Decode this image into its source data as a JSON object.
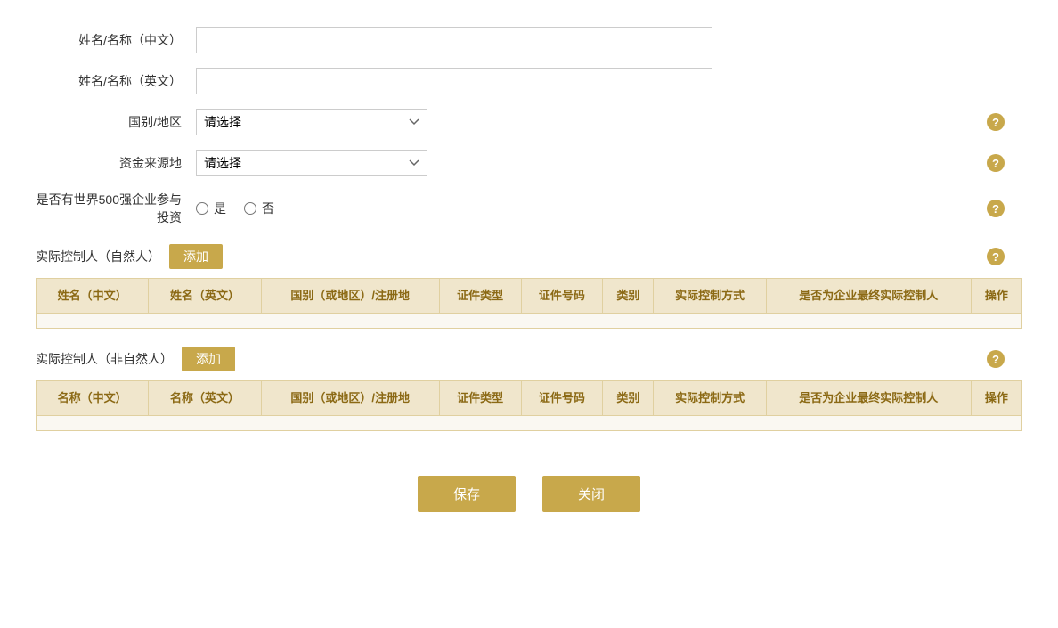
{
  "form": {
    "name_cn_label": "姓名/名称（中文）",
    "name_en_label": "姓名/名称（英文）",
    "country_label": "国别/地区",
    "fund_source_label": "资金来源地",
    "fortune500_label": "是否有世界500强企业参与投资",
    "country_placeholder": "请选择",
    "fund_source_placeholder": "请选择",
    "radio_yes": "是",
    "radio_no": "否"
  },
  "natural_section": {
    "title": "实际控制人（自然人）",
    "add_label": "添加",
    "columns": [
      "姓名（中文）",
      "姓名（英文）",
      "国别（或地区）/注册地",
      "证件类型",
      "证件号码",
      "类别",
      "实际控制方式",
      "是否为企业最终实际控制人",
      "操作"
    ]
  },
  "non_natural_section": {
    "title": "实际控制人（非自然人）",
    "add_label": "添加",
    "columns": [
      "名称（中文）",
      "名称（英文）",
      "国别（或地区）/注册地",
      "证件类型",
      "证件号码",
      "类别",
      "实际控制方式",
      "是否为企业最终实际控制人",
      "操作"
    ]
  },
  "buttons": {
    "save": "保存",
    "close": "关闭"
  },
  "help_icon": "?",
  "accent_color": "#c8a84b"
}
